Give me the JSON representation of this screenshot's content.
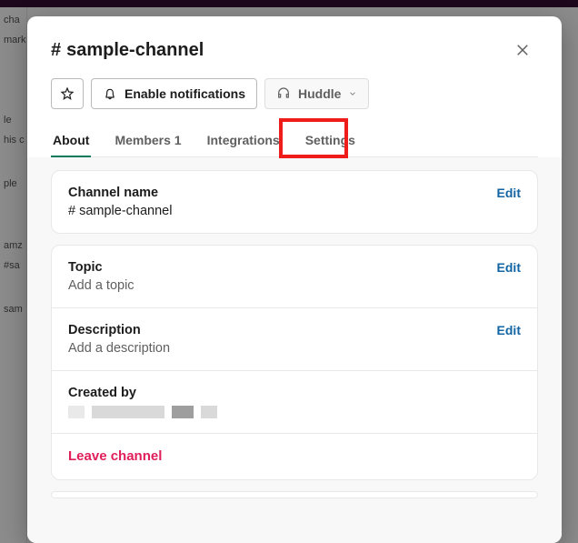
{
  "background": {
    "sidebar": [
      "cha",
      "mark",
      "",
      "",
      "",
      "",
      "le",
      "his c",
      "",
      "ple",
      "",
      "",
      "amz",
      "#sa",
      "",
      "",
      "sam"
    ],
    "main": ""
  },
  "modal": {
    "title_hash": "#",
    "title": "sample-channel",
    "actions": {
      "star_tooltip": "Star",
      "notifications": "Enable notifications",
      "huddle": "Huddle"
    },
    "tabs": {
      "about": "About",
      "members_label": "Members",
      "members_count": "1",
      "integrations": "Integrations",
      "settings": "Settings"
    },
    "sections": {
      "channel_name": {
        "title": "Channel name",
        "hash": "#",
        "value": "sample-channel",
        "edit": "Edit"
      },
      "topic": {
        "title": "Topic",
        "placeholder": "Add a topic",
        "edit": "Edit"
      },
      "description": {
        "title": "Description",
        "placeholder": "Add a description",
        "edit": "Edit"
      },
      "created_by": {
        "title": "Created by"
      },
      "leave": "Leave channel"
    }
  }
}
